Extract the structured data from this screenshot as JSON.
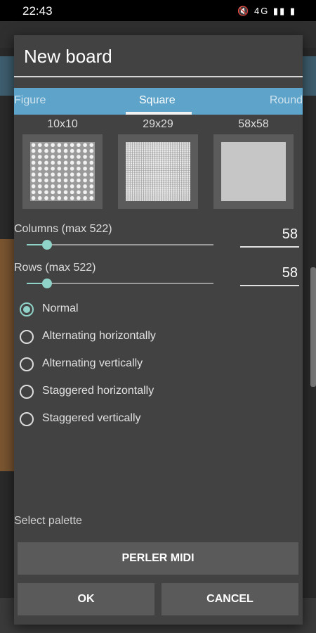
{
  "status_bar": {
    "time": "22:43",
    "icons": "🔇 4G ▮▮ ▮"
  },
  "dialog": {
    "title": "New board",
    "tabs": [
      {
        "label": "Figure",
        "selected": false
      },
      {
        "label": "Square",
        "selected": true
      },
      {
        "label": "Round",
        "selected": false
      }
    ],
    "presets": [
      {
        "label": "10x10"
      },
      {
        "label": "29x29"
      },
      {
        "label": "58x58"
      }
    ],
    "columns": {
      "label": "Columns (max 522)",
      "value": "58",
      "level": 0.11
    },
    "rows": {
      "label": "Rows (max 522)",
      "value": "58",
      "level": 0.11
    },
    "patterns": [
      {
        "label": "Normal",
        "selected": true
      },
      {
        "label": "Alternating horizontally",
        "selected": false
      },
      {
        "label": "Alternating vertically",
        "selected": false
      },
      {
        "label": "Staggered horizontally",
        "selected": false
      },
      {
        "label": "Staggered vertically",
        "selected": false
      }
    ],
    "palette": {
      "label": "Select palette",
      "button_label": "PERLER MIDI"
    },
    "ok_label": "OK",
    "cancel_label": "CANCEL"
  },
  "colors": {
    "accent": "#8fd3c8",
    "tab_bar": "#5ea3c9",
    "dialog_bg": "#424242",
    "button_bg": "#5a5a5a"
  }
}
